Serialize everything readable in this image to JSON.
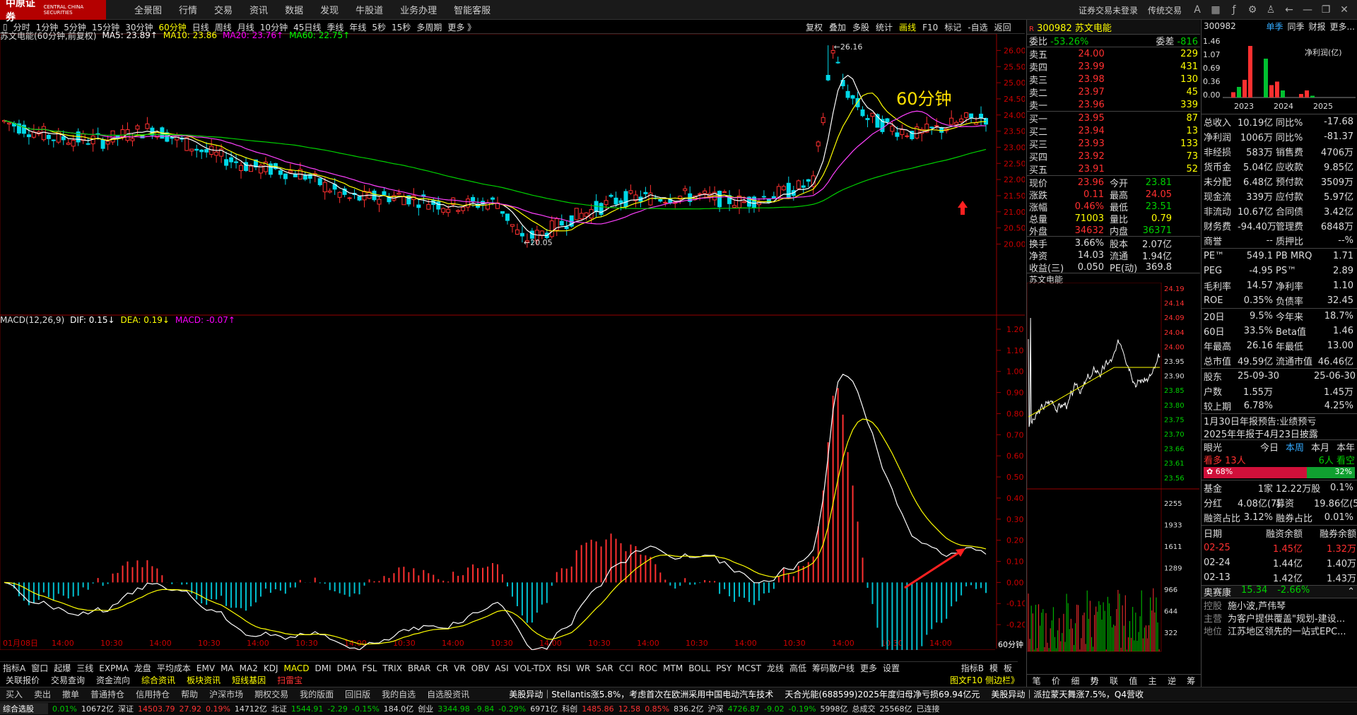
{
  "app": {
    "logo_cn": "中原证券",
    "logo_en": "CENTRAL CHINA SECURITIES",
    "menu": [
      "全景图",
      "行情",
      "交易",
      "资讯",
      "数据",
      "发现",
      "牛股道",
      "业务办理",
      "智能客服"
    ],
    "top_right": [
      "证券交易未登录",
      "传统交易"
    ]
  },
  "periods": [
    "分时",
    "1分钟",
    "5分钟",
    "15分钟",
    "30分钟",
    "60分钟",
    "日线",
    "周线",
    "月线",
    "10分钟",
    "45日线",
    "季线",
    "年线",
    "5秒",
    "15秒",
    "多周期",
    "更多 》"
  ],
  "active_period": "60分钟",
  "tools": [
    "复权",
    "叠加",
    "多股",
    "统计",
    "画线",
    "F10",
    "标记",
    "-自选",
    "返回"
  ],
  "chart": {
    "title": "苏文电能(60分钟,前复权)",
    "ma5": "MA5: 23.89↑",
    "ma10": "MA10: 23.86",
    "ma20": "MA20: 23.76↑",
    "ma60": "MA60: 22.75↑",
    "annotation": "60分钟",
    "high_label": "26.16",
    "low_label": "20.05",
    "price_axis": [
      "26.00",
      "25.50",
      "25.00",
      "24.50",
      "24.00",
      "23.50",
      "23.00",
      "22.50",
      "22.00",
      "21.50",
      "21.00",
      "20.50",
      "20.00"
    ],
    "macd_title": "MACD(12,26,9)",
    "dif": "DIF: 0.15↓",
    "dea": "DEA: 0.19↓",
    "macd": "MACD: -0.07↑",
    "macd_axis": [
      "1.20",
      "1.10",
      "1.00",
      "0.90",
      "0.80",
      "0.70",
      "0.60",
      "0.50",
      "0.40",
      "0.30",
      "0.20",
      "0.10",
      "0.00",
      "-0.10",
      "-0.20"
    ],
    "time_axis": [
      "01月08日",
      "14:00",
      "10:30",
      "14:00",
      "10:30",
      "14:00",
      "10:30",
      "14:00",
      "10:30",
      "14:00",
      "10:30",
      "14:00",
      "10:30",
      "14:00",
      "10:30",
      "14:00",
      "10:30",
      "14:00",
      "10:30",
      "14:00"
    ],
    "period_badge": "60分钟"
  },
  "indicators": [
    "指标A",
    "窗口",
    "起爆",
    "三线",
    "EXPMA",
    "龙盘",
    "平均成本",
    "EMV",
    "MA",
    "MA2",
    "KDJ",
    "MACD",
    "DMI",
    "DMA",
    "FSL",
    "TRIX",
    "BRAR",
    "CR",
    "VR",
    "OBV",
    "ASI",
    "VOL-TDX",
    "RSI",
    "WR",
    "SAR",
    "CCI",
    "ROC",
    "MTM",
    "BOLL",
    "PSY",
    "MCST",
    "龙线",
    "高低",
    "筹码散户线",
    "更多",
    "设置"
  ],
  "active_indicator": "MACD",
  "indicator_right": [
    "指标B",
    "模",
    "板"
  ],
  "subtabs": [
    {
      "t": "关联报价",
      "c": "#ddd"
    },
    {
      "t": "交易查询",
      "c": "#ddd"
    },
    {
      "t": "资金流向",
      "c": "#ddd"
    },
    {
      "t": "综合资讯",
      "c": "#ff0"
    },
    {
      "t": "板块资讯",
      "c": "#ff0"
    },
    {
      "t": "短线基因",
      "c": "#ff0"
    },
    {
      "t": "扫雷宝",
      "c": "#f33"
    }
  ],
  "subtab_right": "图文F10 侧边栏》",
  "toolbar": [
    "买入",
    "卖出",
    "撤单",
    "普通持仓",
    "信用持仓",
    "帮助",
    "沪深市场",
    "期权交易",
    "我的版面",
    "回旧版",
    "我的自选",
    "自选股资讯"
  ],
  "news": [
    "美股异动｜Stellantis涨5.8%，考虑首次在欧洲采用中国电动汽车技术",
    "天合光能(688599)2025年度归母净亏损69.94亿元",
    "美股异动｜派拉蒙天舞涨7.5%，Q4营收"
  ],
  "statusbar": [
    {
      "t": "综合选股",
      "c": "#fff"
    },
    {
      "t": "0.01%",
      "c": "#0c0"
    },
    {
      "t": "10672亿",
      "c": "#ddd"
    },
    {
      "t": "深证",
      "c": "#ddd"
    },
    {
      "t": "14503.79",
      "c": "#f33"
    },
    {
      "t": "27.92",
      "c": "#f33"
    },
    {
      "t": "0.19%",
      "c": "#f33"
    },
    {
      "t": "14712亿",
      "c": "#ddd"
    },
    {
      "t": "北证",
      "c": "#ddd"
    },
    {
      "t": "1544.91",
      "c": "#0c0"
    },
    {
      "t": "-2.29",
      "c": "#0c0"
    },
    {
      "t": "-0.15%",
      "c": "#0c0"
    },
    {
      "t": "184.0亿",
      "c": "#ddd"
    },
    {
      "t": "创业",
      "c": "#ddd"
    },
    {
      "t": "3344.98",
      "c": "#0c0"
    },
    {
      "t": "-9.84",
      "c": "#0c0"
    },
    {
      "t": "-0.29%",
      "c": "#0c0"
    },
    {
      "t": "6971亿",
      "c": "#ddd"
    },
    {
      "t": "科创",
      "c": "#ddd"
    },
    {
      "t": "1485.86",
      "c": "#f33"
    },
    {
      "t": "12.58",
      "c": "#f33"
    },
    {
      "t": "0.85%",
      "c": "#f33"
    },
    {
      "t": "836.2亿",
      "c": "#ddd"
    },
    {
      "t": "沪深",
      "c": "#ddd"
    },
    {
      "t": "4726.87",
      "c": "#0c0"
    },
    {
      "t": "-9.02",
      "c": "#0c0"
    },
    {
      "t": "-0.19%",
      "c": "#0c0"
    },
    {
      "t": "5998亿",
      "c": "#ddd"
    },
    {
      "t": "总成交",
      "c": "#ddd"
    },
    {
      "t": "25568亿",
      "c": "#ddd"
    },
    {
      "t": "已连接",
      "c": "#ddd"
    }
  ],
  "quote": {
    "code": "300982",
    "name": "苏文电能",
    "weibi": "-53.26%",
    "weicha": "-816",
    "asks": [
      {
        "l": "卖五",
        "p": "24.00",
        "v": "229"
      },
      {
        "l": "卖四",
        "p": "23.99",
        "v": "431"
      },
      {
        "l": "卖三",
        "p": "23.98",
        "v": "130"
      },
      {
        "l": "卖二",
        "p": "23.97",
        "v": "45"
      },
      {
        "l": "卖一",
        "p": "23.96",
        "v": "339"
      }
    ],
    "bids": [
      {
        "l": "买一",
        "p": "23.95",
        "v": "87"
      },
      {
        "l": "买二",
        "p": "23.94",
        "v": "13"
      },
      {
        "l": "买三",
        "p": "23.93",
        "v": "133"
      },
      {
        "l": "买四",
        "p": "23.92",
        "v": "73"
      },
      {
        "l": "买五",
        "p": "23.91",
        "v": "52"
      }
    ],
    "stats": [
      {
        "a": "现价",
        "b": "23.96",
        "bc": "r",
        "c": "今开",
        "d": "23.81",
        "dc": "g"
      },
      {
        "a": "涨跌",
        "b": "0.11",
        "bc": "r",
        "c": "最高",
        "d": "24.05",
        "dc": "r"
      },
      {
        "a": "涨幅",
        "b": "0.46%",
        "bc": "r",
        "c": "最低",
        "d": "23.51",
        "dc": "g"
      },
      {
        "a": "总量",
        "b": "71003",
        "bc": "y",
        "c": "量比",
        "d": "0.79",
        "dc": "y"
      },
      {
        "a": "外盘",
        "b": "34632",
        "bc": "r",
        "c": "内盘",
        "d": "36371",
        "dc": "g"
      }
    ],
    "stats2": [
      {
        "a": "换手",
        "b": "3.66%",
        "c": "股本",
        "d": "2.07亿"
      },
      {
        "a": "净资",
        "b": "14.03",
        "c": "流通",
        "d": "1.94亿"
      },
      {
        "a": "收益(三)",
        "b": "0.050",
        "c": "PE(动)",
        "d": "369.8"
      }
    ],
    "mini_title": "苏文电能",
    "mini_axis": [
      "24.19",
      "24.14",
      "24.09",
      "24.04",
      "24.00",
      "23.95",
      "23.90",
      "23.85",
      "23.80",
      "23.75",
      "23.70",
      "23.66",
      "23.61",
      "23.56",
      "2255",
      "1933",
      "1611",
      "1289",
      "966",
      "644",
      "322"
    ]
  },
  "fin": {
    "code": "300982",
    "tabs": [
      "单季",
      "同季",
      "财报",
      "更多..."
    ],
    "chart_title": "净利润(亿)",
    "yaxis": [
      "1.46",
      "1.07",
      "0.69",
      "0.36",
      "0.00"
    ],
    "years": [
      "2023",
      "2024",
      "2025"
    ],
    "rows1": [
      {
        "a": "总收入",
        "b": "10.19亿",
        "c": "同比%",
        "d": "-17.68"
      },
      {
        "a": "净利润",
        "b": "1006万",
        "c": "同比%",
        "d": "-81.37"
      },
      {
        "a": "非经损",
        "b": "583万",
        "c": "销售费",
        "d": "4706万"
      },
      {
        "a": "货币金",
        "b": "5.04亿",
        "c": "应收款",
        "d": "9.85亿"
      },
      {
        "a": "未分配",
        "b": "6.48亿",
        "c": "预付款",
        "d": "3509万"
      },
      {
        "a": "现金流",
        "b": "339万",
        "c": "应付款",
        "d": "5.97亿"
      },
      {
        "a": "非流动",
        "b": "10.67亿",
        "c": "合同债",
        "d": "3.42亿"
      },
      {
        "a": "财务费",
        "b": "-94.40万",
        "c": "管理费",
        "d": "6848万"
      },
      {
        "a": "商誉",
        "b": "--",
        "c": "质押比",
        "d": "--%"
      }
    ],
    "rows2": [
      {
        "a": "PE™",
        "b": "549.1",
        "c": "PB MRQ",
        "d": "1.71"
      },
      {
        "a": "PEG",
        "b": "-4.95",
        "c": "PS™",
        "d": "2.89"
      },
      {
        "a": "毛利率",
        "b": "14.57",
        "c": "净利率",
        "d": "1.10"
      },
      {
        "a": "ROE",
        "b": "0.35%",
        "c": "负债率",
        "d": "32.45"
      }
    ],
    "rows3": [
      {
        "a": "20日",
        "b": "9.5%",
        "c": "今年来",
        "d": "18.7%"
      },
      {
        "a": "60日",
        "b": "33.5%",
        "c": "Beta值",
        "d": "1.46"
      },
      {
        "a": "年最高",
        "b": "26.16",
        "c": "年最低",
        "d": "13.00"
      },
      {
        "a": "总市值",
        "b": "49.59亿",
        "c": "流通市值",
        "d": "46.46亿"
      }
    ],
    "rows4": [
      {
        "a": "股东",
        "b": "25-09-30",
        "c": "",
        "d": "25-06-30"
      },
      {
        "a": "户数",
        "b": "1.55万",
        "c": "",
        "d": "1.45万"
      },
      {
        "a": "较上期",
        "b": "6.78%",
        "c": "",
        "d": "4.25%"
      }
    ],
    "notice1": "1月30日年报预告:业绩预亏",
    "notice2": "2025年年报于4月23日披露",
    "eyes": {
      "label": "眼光",
      "tabs": [
        "今日",
        "本周",
        "本月",
        "本年"
      ],
      "bull": "看多",
      "bull_n": "13人",
      "bear": "6人",
      "bear_l": "看空",
      "bull_pct": "68%",
      "bear_pct": "32%"
    },
    "rows5": [
      {
        "a": "基金",
        "b": "1家",
        "c": "12.22万股",
        "d": "0.1%"
      },
      {
        "a": "分红",
        "b": "4.08亿(7)",
        "c": "募资",
        "d": "19.86亿(5)"
      },
      {
        "a": "融资占比",
        "b": "3.12%",
        "c": "融券占比",
        "d": "0.01%"
      }
    ],
    "margin_head": [
      "日期",
      "融资余额",
      "融券余额"
    ],
    "margin": [
      [
        "02-25",
        "1.45亿",
        "1.32万"
      ],
      [
        "02-24",
        "1.44亿",
        "1.40万"
      ],
      [
        "02-13",
        "1.42亿",
        "1.43万"
      ]
    ],
    "peer": {
      "name": "奥赛康",
      "price": "15.34",
      "pct": "-2.66%"
    },
    "info": [
      {
        "a": "控股",
        "b": "施小波,芦伟琴"
      },
      {
        "a": "主营",
        "b": "为客户提供覆盖\"规划-建设..."
      },
      {
        "a": "地位",
        "b": "江苏地区领先的一站式EPC..."
      }
    ]
  }
}
